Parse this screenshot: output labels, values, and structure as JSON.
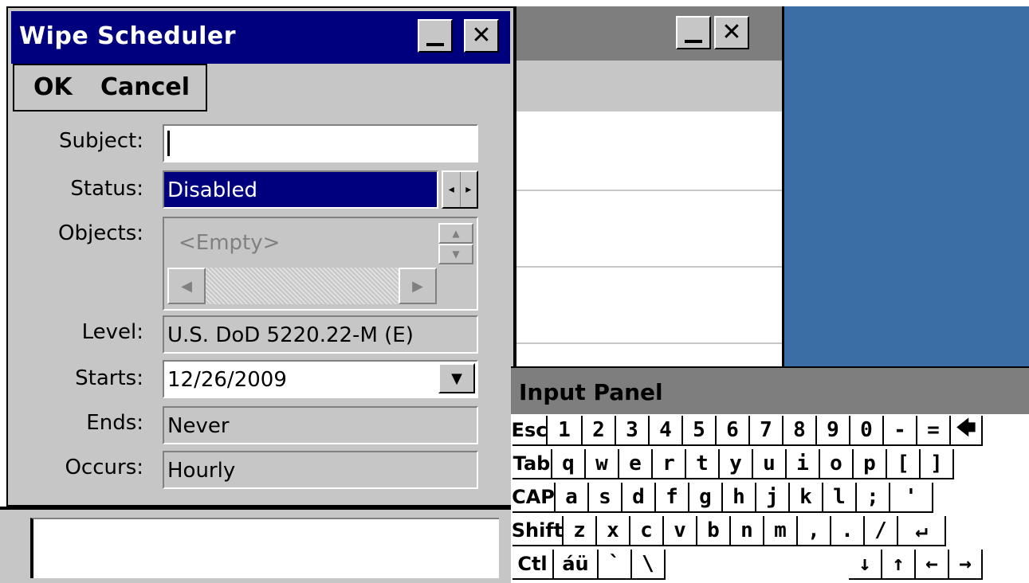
{
  "dialog": {
    "title": "Wipe Scheduler",
    "minimize_glyph": "_",
    "close_glyph": "✕",
    "commands": {
      "ok": "OK",
      "cancel": "Cancel"
    },
    "fields": {
      "subject": {
        "label": "Subject:",
        "value": ""
      },
      "status": {
        "label": "Status:",
        "value": "Disabled"
      },
      "objects": {
        "label": "Objects:",
        "value": "<Empty>"
      },
      "level": {
        "label": "Level:",
        "value": "U.S. DoD 5220.22-M (E)"
      },
      "starts": {
        "label": "Starts:",
        "value": "12/26/2009"
      },
      "ends": {
        "label": "Ends:",
        "value": "Never"
      },
      "occurs": {
        "label": "Occurs:",
        "value": "Hourly"
      }
    },
    "spin_glyphs": {
      "left": "◂",
      "right": "▸"
    },
    "scroll_glyphs": {
      "up": "▲",
      "down": "▼",
      "left": "◀",
      "right": "▶"
    },
    "dropdown_glyph": "▼"
  },
  "bg_window": {
    "minimize_glyph": "_",
    "close_glyph": "✕"
  },
  "input_panel": {
    "title": "Input Panel",
    "rows": [
      [
        "Esc",
        "1",
        "2",
        "3",
        "4",
        "5",
        "6",
        "7",
        "8",
        "9",
        "0",
        "-",
        "=",
        "🡄"
      ],
      [
        "Tab",
        "q",
        "w",
        "e",
        "r",
        "t",
        "y",
        "u",
        "i",
        "o",
        "p",
        "[",
        "]"
      ],
      [
        "CAP",
        "a",
        "s",
        "d",
        "f",
        "g",
        "h",
        "j",
        "k",
        "l",
        ";",
        "'"
      ],
      [
        "Shift",
        "z",
        "x",
        "c",
        "v",
        "b",
        "n",
        "m",
        ",",
        ".",
        "/",
        "↵"
      ],
      [
        "Ctl",
        "áü",
        "`",
        "\\",
        "",
        "↓",
        "↑",
        "←",
        "→"
      ]
    ]
  },
  "colors": {
    "title_active": "#00007f",
    "face": "#c6c6c6",
    "desktop": "#3a6ea5",
    "title_inactive": "#7e7e7e"
  }
}
